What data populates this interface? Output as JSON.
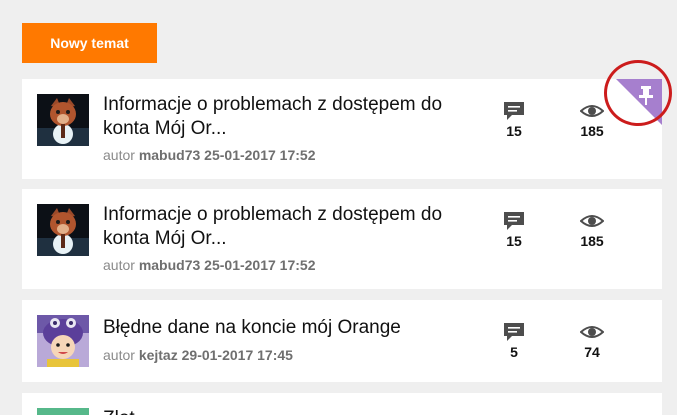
{
  "toolbar": {
    "new_topic_label": "Nowy temat"
  },
  "colors": {
    "accent": "#ff7900",
    "pin_corner": "#a67fce",
    "highlight": "#cc1c1c"
  },
  "icons": {
    "replies": "speech-bubble-icon",
    "views": "eye-icon",
    "pinned": "pin-icon"
  },
  "topics": [
    {
      "title": "Informacje o problemach z dostępem do konta Mój Or...",
      "author_prefix": "autor",
      "author": "mabud73",
      "date": "25-01-2017 17:52",
      "replies": "15",
      "views": "185",
      "pinned": true
    },
    {
      "title": "Informacje o problemach z dostępem do konta Mój Or...",
      "author_prefix": "autor",
      "author": "mabud73",
      "date": "25-01-2017 17:52",
      "replies": "15",
      "views": "185",
      "pinned": false
    },
    {
      "title": "Błędne dane na koncie mój Orange",
      "author_prefix": "autor",
      "author": "kejtaz",
      "date": "29-01-2017 17:45",
      "replies": "5",
      "views": "74",
      "pinned": false
    },
    {
      "title": "Zlot…",
      "author_prefix": "",
      "author": "",
      "date": "",
      "replies": "",
      "views": "",
      "pinned": false
    }
  ]
}
